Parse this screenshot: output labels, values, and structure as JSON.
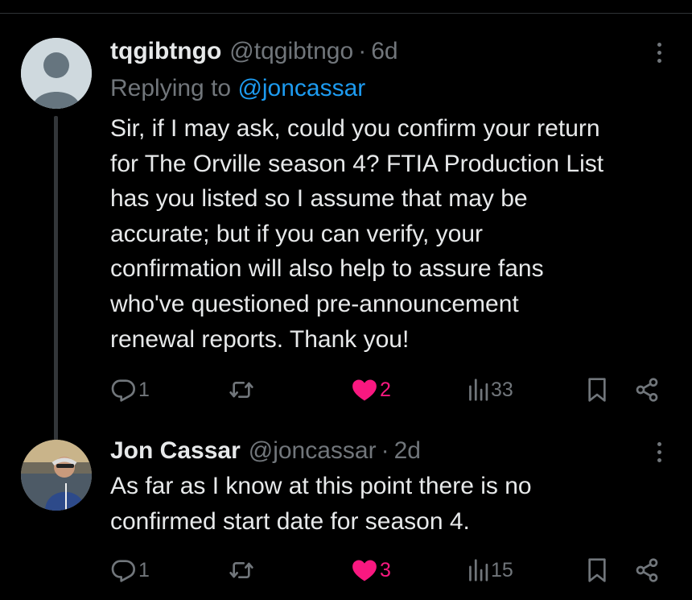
{
  "tweets": [
    {
      "name": "tqgibtngo",
      "handle": "@tqgibtngo",
      "time": "6d",
      "replying_prefix": "Replying to ",
      "replying_handle": "@joncassar",
      "text": "Sir, if I may ask, could you confirm your return\nfor The Orville season 4?  FTIA Production List\nhas you listed so I assume that may be\naccurate; but if you can verify, your\nconfirmation will also help to assure fans\nwho've questioned pre-announcement\nrenewal reports.  Thank you!",
      "replies": "1",
      "likes": "2",
      "views": "33"
    },
    {
      "name": "Jon Cassar",
      "handle": "@joncassar",
      "time": "2d",
      "text": "As far as I know at this point there is no\nconfirmed start date for season 4.",
      "replies": "1",
      "likes": "3",
      "views": "15"
    }
  ],
  "separator": "·",
  "colors": {
    "background": "#000000",
    "text": "#e7e9ea",
    "secondary": "#71767b",
    "link": "#1d9bf0",
    "like": "#f91880"
  },
  "icons": [
    "reply-icon",
    "retweet-icon",
    "heart-icon",
    "views-icon",
    "bookmark-icon",
    "share-icon",
    "more-icon"
  ]
}
